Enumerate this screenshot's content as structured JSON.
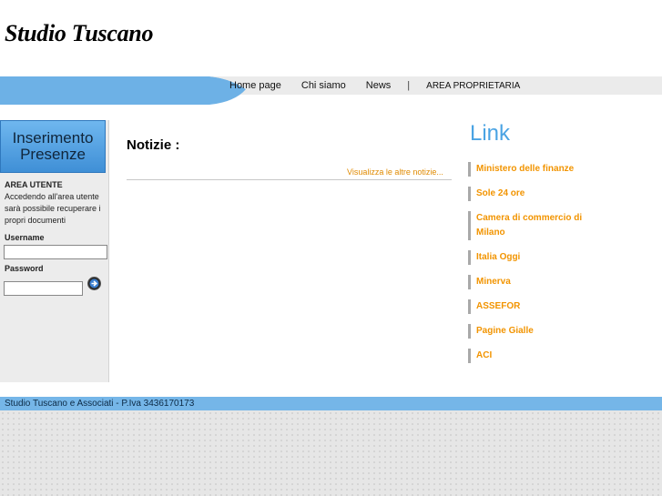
{
  "header": {
    "logo": "Studio Tuscano"
  },
  "nav": {
    "items": [
      "Home page",
      "Chi siamo",
      "News"
    ],
    "separator": "|",
    "area": "AREA PROPRIETARIA"
  },
  "sidebar": {
    "button_line1": "Inserimento",
    "button_line2": "Presenze",
    "area_title": "AREA UTENTE",
    "area_desc": "Accedendo all'area utente sarà possibile recuperare i propri documenti",
    "username_label": "Username",
    "username_value": "",
    "password_label": "Password",
    "password_value": ""
  },
  "main": {
    "title": "Notizie :",
    "more_link": "Visualizza le altre notizie..."
  },
  "links": {
    "title": "Link",
    "items": [
      "Ministero delle finanze",
      "Sole 24 ore",
      "Camera di commercio di Milano",
      "Italia Oggi",
      "Minerva",
      "ASSEFOR",
      "Pagine Gialle",
      "ACI"
    ]
  },
  "footer": {
    "text": "Studio Tuscano e Associati - P.Iva 3436170173"
  },
  "colors": {
    "accent_blue": "#4aa3e3",
    "link_orange": "#f29400",
    "footer_blue": "#75b6e8"
  }
}
